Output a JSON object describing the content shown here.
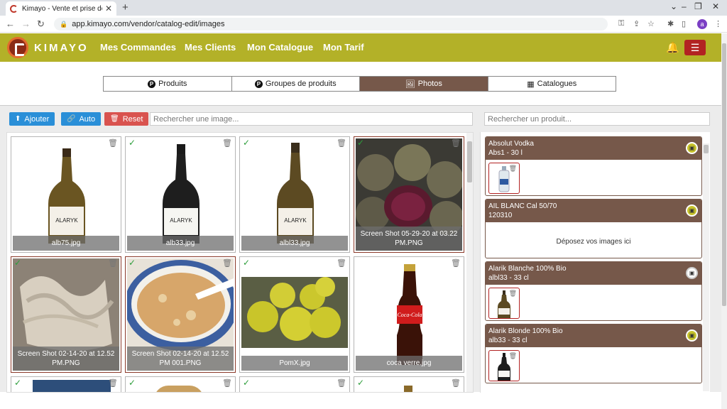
{
  "browser": {
    "tab_title": "Kimayo - Vente et prise de comm",
    "url": "app.kimayo.com/vendor/catalog-edit/images",
    "profile_initial": "a"
  },
  "app": {
    "brand": "KIMAYO",
    "nav": [
      "Mes Commandes",
      "Mes Clients",
      "Mon Catalogue",
      "Mon Tarif"
    ]
  },
  "modes": [
    "Produits",
    "Groupes de produits",
    "Photos",
    "Catalogues"
  ],
  "toolbar": {
    "add": "Ajouter",
    "auto": "Auto",
    "reset": "Reset",
    "image_search_placeholder": "Rechercher une image...",
    "product_search_placeholder": "Rechercher un produit..."
  },
  "images": [
    {
      "caption": "alb75.jpg",
      "checked": false
    },
    {
      "caption": "alb33.jpg",
      "checked": true
    },
    {
      "caption": "albl33.jpg",
      "checked": true
    },
    {
      "caption": "Screen Shot 05-29-20 at 03.22 PM.PNG",
      "checked": true
    },
    {
      "caption": "Screen Shot 02-14-20 at 12.52 PM.PNG",
      "checked": true
    },
    {
      "caption": "Screen Shot 02-14-20 at 12.52 PM 001.PNG",
      "checked": true
    },
    {
      "caption": "PomX.jpg",
      "checked": true
    },
    {
      "caption": "coca verre.jpg",
      "checked": false
    }
  ],
  "products": [
    {
      "name": "Absolut Vodka",
      "ref": "Abs1 - 30 l"
    },
    {
      "name": "AIL BLANC Cal 50/70",
      "ref": "120310",
      "drop_text": "Déposez vos images ici"
    },
    {
      "name": "Alarik Blanche 100% Bio",
      "ref": "albl33 - 33 cl"
    },
    {
      "name": "Alarik Blonde 100% Bio",
      "ref": "alb33 - 33 cl"
    }
  ],
  "colors": {
    "header": "#b3b128",
    "active_tab": "#76584a",
    "button_blue": "#2a8fd8",
    "button_red": "#d9534f"
  }
}
